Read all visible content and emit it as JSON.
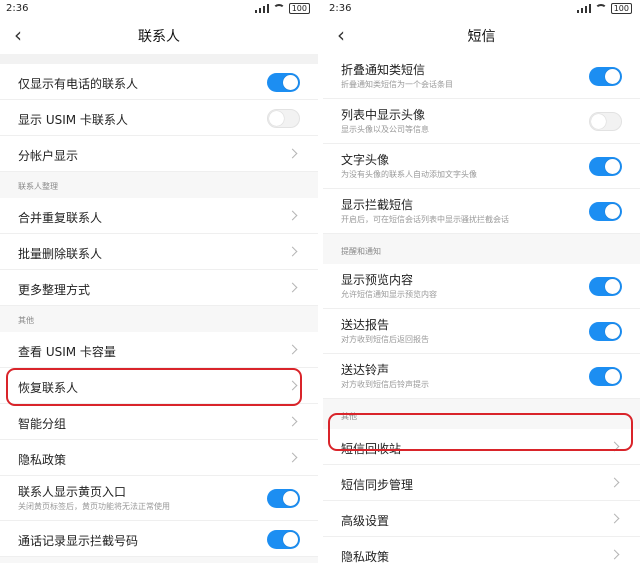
{
  "left": {
    "status_time": "2:36",
    "battery": "100",
    "title": "联系人",
    "rows_a": [
      {
        "label": "仅显示有电话的联系人",
        "control": "toggle-on"
      },
      {
        "label": "显示 USIM 卡联系人",
        "control": "toggle-off"
      },
      {
        "label": "分帐户显示",
        "control": "chevron"
      }
    ],
    "section1": "联系人整理",
    "rows_b": [
      {
        "label": "合并重复联系人"
      },
      {
        "label": "批量删除联系人"
      },
      {
        "label": "更多整理方式"
      }
    ],
    "section2": "其他",
    "rows_c": [
      {
        "label": "查看 USIM 卡容量"
      },
      {
        "label": "恢复联系人"
      },
      {
        "label": "智能分组"
      },
      {
        "label": "隐私政策"
      }
    ],
    "yellow_page": {
      "label": "联系人显示黄页入口",
      "sub": "关闭黄页标签后，黄页功能将无法正常使用"
    },
    "call_log": {
      "label": "通话记录显示拦截号码"
    }
  },
  "right": {
    "status_time": "2:36",
    "battery": "100",
    "title": "短信",
    "rows_a": [
      {
        "label": "折叠通知类短信",
        "sub": "折叠通知类短信为一个会话条目",
        "control": "toggle-on"
      },
      {
        "label": "列表中显示头像",
        "sub": "显示头像以及公司等信息",
        "control": "toggle-off"
      },
      {
        "label": "文字头像",
        "sub": "为没有头像的联系人自动添加文字头像",
        "control": "toggle-on"
      },
      {
        "label": "显示拦截短信",
        "sub": "开启后，可在短信会话列表中显示骚扰拦截会话",
        "control": "toggle-on"
      }
    ],
    "section1": "提醒和通知",
    "rows_b": [
      {
        "label": "显示预览内容",
        "sub": "允许短信通知显示预览内容",
        "control": "toggle-on"
      },
      {
        "label": "送达报告",
        "sub": "对方收到短信后返回报告",
        "control": "toggle-on"
      },
      {
        "label": "送达铃声",
        "sub": "对方收到短信后铃声提示",
        "control": "toggle-on"
      }
    ],
    "section2": "其他",
    "rows_c": [
      {
        "label": "短信回收站"
      },
      {
        "label": "短信同步管理"
      },
      {
        "label": "高级设置"
      },
      {
        "label": "隐私政策"
      }
    ]
  },
  "colors": {
    "accent": "#1c8ef2",
    "highlight": "#d9242a"
  },
  "icons": [
    "back-arrow-icon",
    "chevron-right-icon",
    "signal-icon",
    "wifi-icon",
    "battery-icon"
  ]
}
